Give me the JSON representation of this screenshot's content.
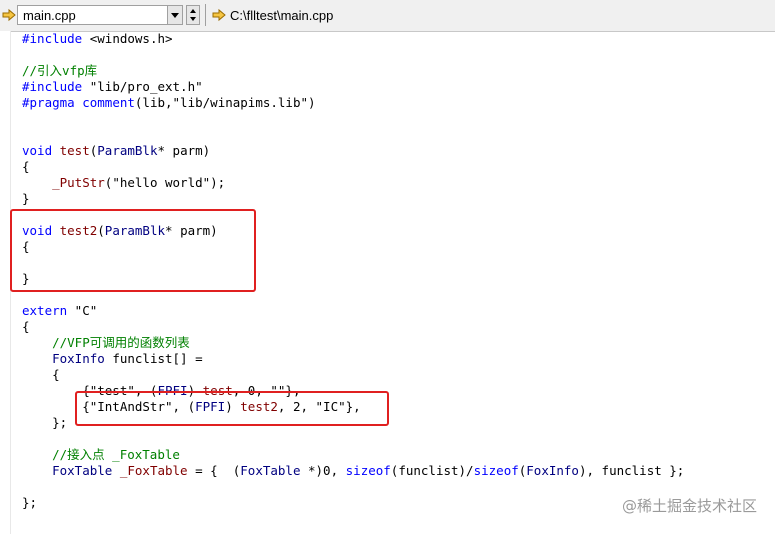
{
  "toolbar": {
    "file_combo_value": "main.cpp",
    "path_value": "C:\\flltest\\main.cpp",
    "arrow_icon": "go-to-arrow-icon",
    "dropdown_icon": "chevron-down-icon",
    "spin_icons": [
      "spin-up-icon",
      "spin-down-icon"
    ]
  },
  "code": {
    "l1_pp": "#include",
    "l1_rest": " <windows.h>",
    "l3": "//引入vfp库",
    "l4_pp": "#include",
    "l4_rest": " \"lib/pro_ext.h\"",
    "l5_pp": "#pragma",
    "l5_kw": " comment",
    "l5_rest": "(lib,\"lib/winapims.lib\")",
    "l8_kw": "void",
    "l8_fn": " test",
    "l8_a": "(",
    "l8_tp": "ParamBlk",
    "l8_b": "* parm)",
    "l9": "{",
    "l10_fn": "    _PutStr",
    "l10_rest": "(\"hello world\");",
    "l11": "}",
    "l13_kw": "void",
    "l13_fn": " test2",
    "l13_a": "(",
    "l13_tp": "ParamBlk",
    "l13_b": "* parm)",
    "l14": "{",
    "l16": "}",
    "l18_kw": "extern",
    "l18_rest": " \"C\"",
    "l19": "{",
    "l20": "    //VFP可调用的函数列表",
    "l21_tp": "    FoxInfo",
    "l21_rest": " funclist[] =",
    "l22": "    {",
    "l23_a": "        {\"test\", (",
    "l23_tp": "FPFI",
    "l23_b": ") ",
    "l23_fn": "test",
    "l23_c": ", 0, \"\"},",
    "l24_a": "        {\"IntAndStr\", (",
    "l24_tp": "FPFI",
    "l24_b": ") ",
    "l24_fn": "test2",
    "l24_c": ", 2, \"IC\"},",
    "l25": "    };",
    "l27": "    //接入点 _FoxTable",
    "l28_tp": "    FoxTable",
    "l28_fn": " _FoxTable",
    "l28_a": " = {  (",
    "l28_tp2": "FoxTable",
    "l28_b": " *)0, ",
    "l28_kw": "sizeof",
    "l28_c": "(funclist)/",
    "l28_kw2": "sizeof",
    "l28_d": "(",
    "l28_tp3": "FoxInfo",
    "l28_e": "), funclist };",
    "l30": "};"
  },
  "colors": {
    "keyword": "#0000ff",
    "type": "#000080",
    "function": "#800000",
    "comment": "#008000",
    "highlight": "#e02020"
  },
  "watermark": "@稀土掘金技术社区"
}
